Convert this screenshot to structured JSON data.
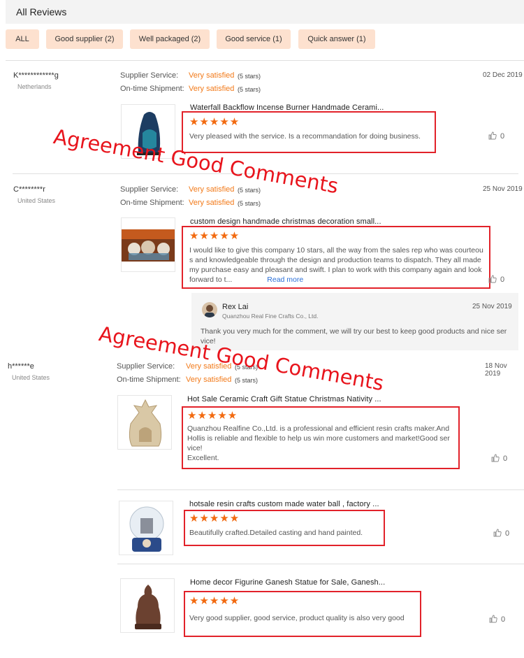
{
  "header": {
    "title": "All Reviews"
  },
  "filters": [
    {
      "label": "ALL"
    },
    {
      "label": "Good supplier (2)"
    },
    {
      "label": "Well packaged (2)"
    },
    {
      "label": "Good service (1)"
    },
    {
      "label": "Quick answer (1)"
    }
  ],
  "labels": {
    "supplier_service": "Supplier Service:",
    "ontime_shipment": "On-time Shipment:",
    "satisfied": "Very satisfied",
    "five_stars": "(5 stars)",
    "star_glyphs": "★★★★★"
  },
  "reviews": [
    {
      "buyer": "K************g",
      "country": "Netherlands",
      "date": "02 Dec 2019",
      "items": [
        {
          "title": "Waterfall Backflow Incense Burner Handmade Cerami...",
          "comment": "Very pleased with the service. Is a recommandation for doing business.",
          "likes": "0"
        }
      ]
    },
    {
      "buyer": "C********r",
      "country": "United States",
      "date": "25 Nov 2019",
      "items": [
        {
          "title": "custom design handmade christmas decoration small...",
          "comment": "I would like to give this company 10 stars, all the way from the sales rep who was courteou s and knowledgeable through the design and production teams to dispatch. They all made my purchase easy and pleasant and swift.  I plan to work with this company again and look forward to t...",
          "read_more": "Read more",
          "likes": "0"
        }
      ],
      "reply": {
        "name": "Rex Lai",
        "company": "Quanzhou Real Fine Crafts Co., Ltd.",
        "date": "25 Nov 2019",
        "text": "Thank you very much for the comment, we will try our best to keep good products and nice ser vice!"
      }
    },
    {
      "buyer": "h******e",
      "country": "United States",
      "date": "18 Nov 2019",
      "items": [
        {
          "title": "Hot Sale Ceramic Craft Gift Statue Christmas Nativity ...",
          "comment": "Quanzhou Realfine Co.,Ltd. is a professional and efficient resin crafts maker.And Hollis is reliable and flexible to help us win more customers and market!Good ser vice!\nExcellent.",
          "likes": "0"
        },
        {
          "title": "hotsale resin crafts custom made water ball , factory ...",
          "comment": "Beautifully crafted.Detailed casting and hand painted.",
          "likes": "0"
        },
        {
          "title": "Home decor Figurine Ganesh Statue for Sale, Ganesh...",
          "comment": "Very good supplier, good service, product quality is also very good",
          "likes": "0"
        }
      ]
    }
  ],
  "watermark": "Agreement Good Comments",
  "colors": {
    "accent": "#f27a1a",
    "chip_bg": "#fde1cf",
    "annotation": "#e2222a",
    "link": "#2a6fd8"
  }
}
